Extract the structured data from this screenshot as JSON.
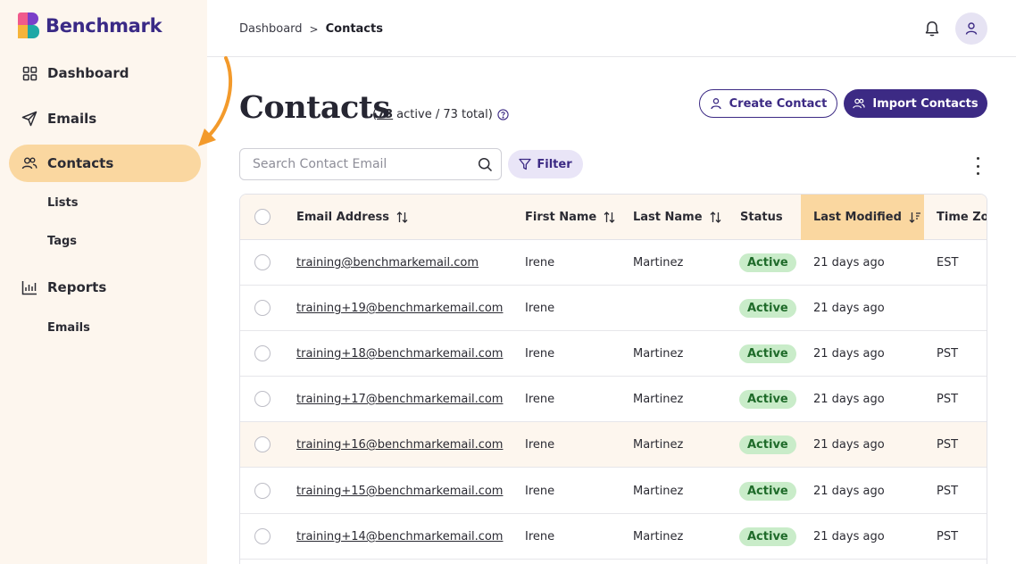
{
  "brand": {
    "name": "Benchmark"
  },
  "sidebar": {
    "items": [
      {
        "label": "Dashboard",
        "icon": "grid-icon"
      },
      {
        "label": "Emails",
        "icon": "paper-plane-icon"
      },
      {
        "label": "Contacts",
        "icon": "users-icon",
        "active": true
      },
      {
        "label": "Lists"
      },
      {
        "label": "Tags"
      },
      {
        "label": "Reports",
        "icon": "bar-chart-icon"
      },
      {
        "label": "Emails"
      }
    ]
  },
  "breadcrumb": {
    "parent": "Dashboard",
    "separator": ">",
    "current": "Contacts"
  },
  "header": {
    "title": "Contacts",
    "active_count": "73",
    "active_text": "active / 73 total)",
    "open_paren": "("
  },
  "actions": {
    "create_label": "Create Contact",
    "import_label": "Import Contacts"
  },
  "search": {
    "placeholder": "Search Contact Email",
    "value": ""
  },
  "filter": {
    "label": "Filter"
  },
  "table": {
    "columns": [
      "Email Address",
      "First Name",
      "Last Name",
      "Status",
      "Last Modified",
      "Time Zone"
    ],
    "sorted_column": "Last Modified",
    "rows": [
      {
        "email": "training@benchmarkemail.com",
        "first": "Irene",
        "last": "Martinez",
        "status": "Active",
        "modified": "21 days ago",
        "tz": "EST"
      },
      {
        "email": "training+19@benchmarkemail.com",
        "first": "Irene",
        "last": "",
        "status": "Active",
        "modified": "21 days ago",
        "tz": ""
      },
      {
        "email": "training+18@benchmarkemail.com",
        "first": "Irene",
        "last": "Martinez",
        "status": "Active",
        "modified": "21 days ago",
        "tz": "PST"
      },
      {
        "email": "training+17@benchmarkemail.com",
        "first": "Irene",
        "last": "Martinez",
        "status": "Active",
        "modified": "21 days ago",
        "tz": "PST"
      },
      {
        "email": "training+16@benchmarkemail.com",
        "first": "Irene",
        "last": "Martinez",
        "status": "Active",
        "modified": "21 days ago",
        "tz": "PST"
      },
      {
        "email": "training+15@benchmarkemail.com",
        "first": "Irene",
        "last": "Martinez",
        "status": "Active",
        "modified": "21 days ago",
        "tz": "PST"
      },
      {
        "email": "training+14@benchmarkemail.com",
        "first": "Irene",
        "last": "Martinez",
        "status": "Active",
        "modified": "21 days ago",
        "tz": "PST"
      }
    ]
  },
  "colors": {
    "brand_purple": "#3c2a84",
    "sidebar_bg": "#fdf6ee",
    "active_nav": "#fad7a0",
    "badge_bg": "#c9ecc9",
    "annotation_arrow": "#f39a2b"
  }
}
